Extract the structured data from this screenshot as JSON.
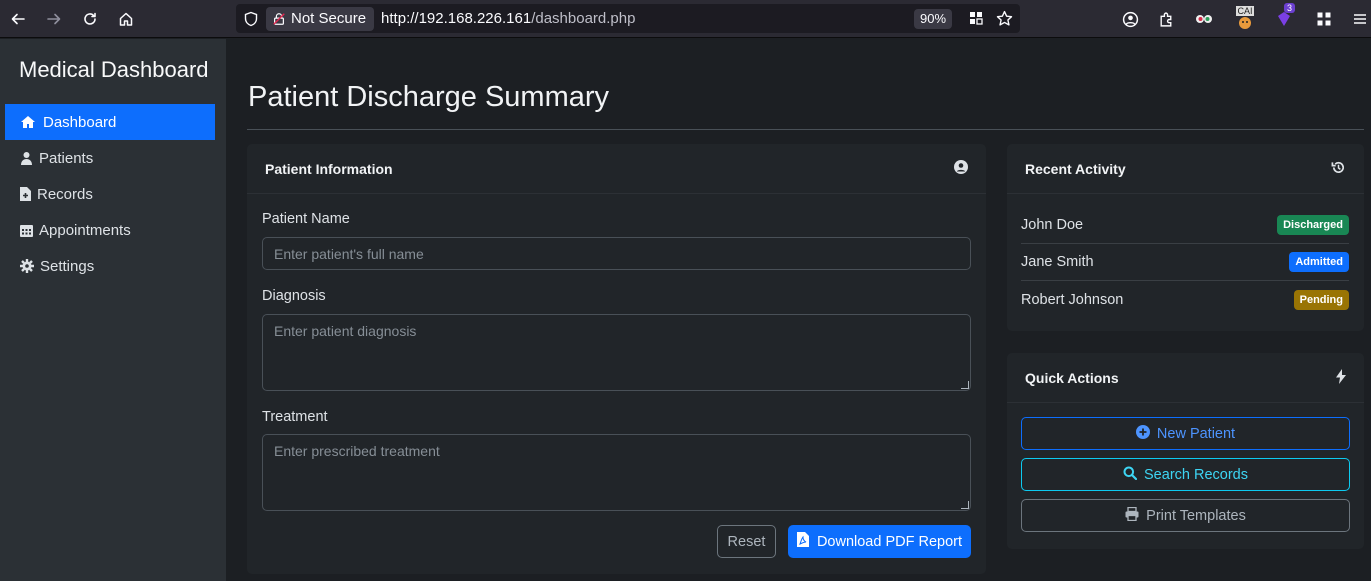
{
  "browser": {
    "security_label": "Not Secure",
    "url_host": "http://192.168.226.161",
    "url_path": "/dashboard.php",
    "zoom": "90%",
    "ext_badge_count": "3",
    "ext_label": "CAI"
  },
  "sidebar": {
    "brand": "Medical Dashboard",
    "items": [
      {
        "label": "Dashboard",
        "icon": "home-icon",
        "active": true
      },
      {
        "label": "Patients",
        "icon": "user-injured-icon"
      },
      {
        "label": "Records",
        "icon": "file-medical-icon"
      },
      {
        "label": "Appointments",
        "icon": "calendar-icon"
      },
      {
        "label": "Settings",
        "icon": "gear-icon"
      }
    ]
  },
  "main": {
    "title": "Patient Discharge Summary",
    "patient_card": {
      "header": "Patient Information",
      "name_label": "Patient Name",
      "name_placeholder": "Enter patient's full name",
      "diagnosis_label": "Diagnosis",
      "diagnosis_placeholder": "Enter patient diagnosis",
      "treatment_label": "Treatment",
      "treatment_placeholder": "Enter prescribed treatment",
      "reset_label": "Reset",
      "download_label": "Download PDF Report"
    },
    "activity_card": {
      "header": "Recent Activity",
      "items": [
        {
          "name": "John Doe",
          "status": "Discharged",
          "color": "#198754"
        },
        {
          "name": "Jane Smith",
          "status": "Admitted",
          "color": "#0d6efd"
        },
        {
          "name": "Robert Johnson",
          "status": "Pending",
          "color": "#997404"
        }
      ]
    },
    "quick_actions": {
      "header": "Quick Actions",
      "new_patient": "New Patient",
      "search_records": "Search Records",
      "print_templates": "Print Templates"
    }
  },
  "colors": {
    "primary": "#0d6efd",
    "info": "#0dcaf0",
    "secondary": "#6c757d"
  }
}
